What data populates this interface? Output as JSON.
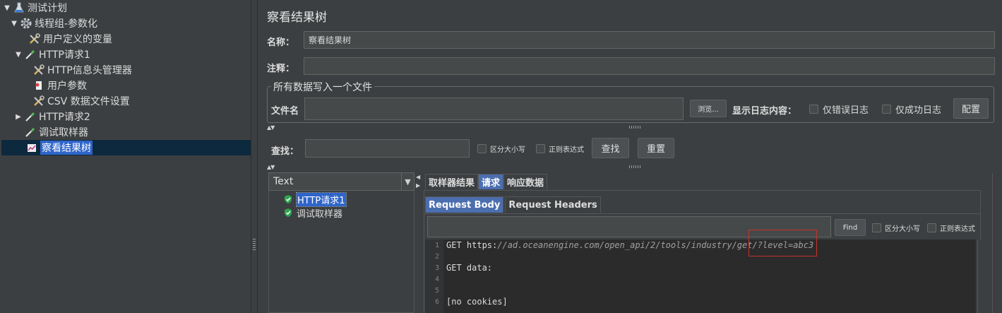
{
  "tree": {
    "nodes": [
      {
        "toggle": "▼",
        "label": "测试计划",
        "icon": "flask-icon"
      },
      {
        "toggle": "▼",
        "label": "线程组-参数化",
        "icon": "gear-icon"
      },
      {
        "toggle": "",
        "label": "用户定义的变量",
        "icon": "wrench-icon"
      },
      {
        "toggle": "▼",
        "label": "HTTP请求1",
        "icon": "pipette-icon"
      },
      {
        "toggle": "",
        "label": "HTTP信息头管理器",
        "icon": "wrench-icon"
      },
      {
        "toggle": "",
        "label": "用户参数",
        "icon": "bookmark-icon"
      },
      {
        "toggle": "",
        "label": "CSV 数据文件设置",
        "icon": "wrench-icon"
      },
      {
        "toggle": "▶",
        "label": "HTTP请求2",
        "icon": "pipette-icon"
      },
      {
        "toggle": "",
        "label": "调试取样器",
        "icon": "pipette-icon"
      },
      {
        "toggle": "",
        "label": "察看结果树",
        "icon": "chart-icon"
      }
    ]
  },
  "panel": {
    "title": "察看结果树",
    "name_label": "名称：",
    "name_value": "察看结果树",
    "comment_label": "注释：",
    "comment_value": "",
    "fieldset_legend": "所有数据写入一个文件",
    "file_label": "文件名",
    "file_value": "",
    "browse_label": "浏览...",
    "log_label": "显示日志内容：",
    "errors_only": "仅错误日志",
    "success_only": "仅成功日志",
    "configure_label": "配置"
  },
  "search": {
    "label": "查找：",
    "value": "",
    "case_sensitive": "区分大小写",
    "regex": "正则表达式",
    "search_button": "查找",
    "reset_button": "重置"
  },
  "results": {
    "renderer": "Text",
    "items": [
      {
        "label": "HTTP请求1",
        "selected": true
      },
      {
        "label": "调试取样器",
        "selected": false
      }
    ]
  },
  "tabs": [
    "取样器结果",
    "请求",
    "响应数据"
  ],
  "subtabs": [
    "Request Body",
    "Request Headers"
  ],
  "find": {
    "value": "",
    "button": "Find",
    "case_sensitive": "区分大小写",
    "regex": "正则表达式"
  },
  "editor": {
    "lines": [
      {
        "num": "1",
        "prefix": "GET https:",
        "url": "//ad.oceanengine.com/open_api/2/tools/industry/get/?level=abc3"
      },
      {
        "num": "2",
        "prefix": "",
        "url": ""
      },
      {
        "num": "3",
        "prefix": "GET data:",
        "url": ""
      },
      {
        "num": "4",
        "prefix": "",
        "url": ""
      },
      {
        "num": "5",
        "prefix": "",
        "url": ""
      },
      {
        "num": "6",
        "prefix": "[no cookies]",
        "url": ""
      }
    ]
  },
  "colors": {
    "background": "#3c3f41",
    "selection": "#2f65ca",
    "active_tab": "#4b6eaf",
    "highlight_box": "#c8312a",
    "editor_bg": "#2b2b2b"
  }
}
